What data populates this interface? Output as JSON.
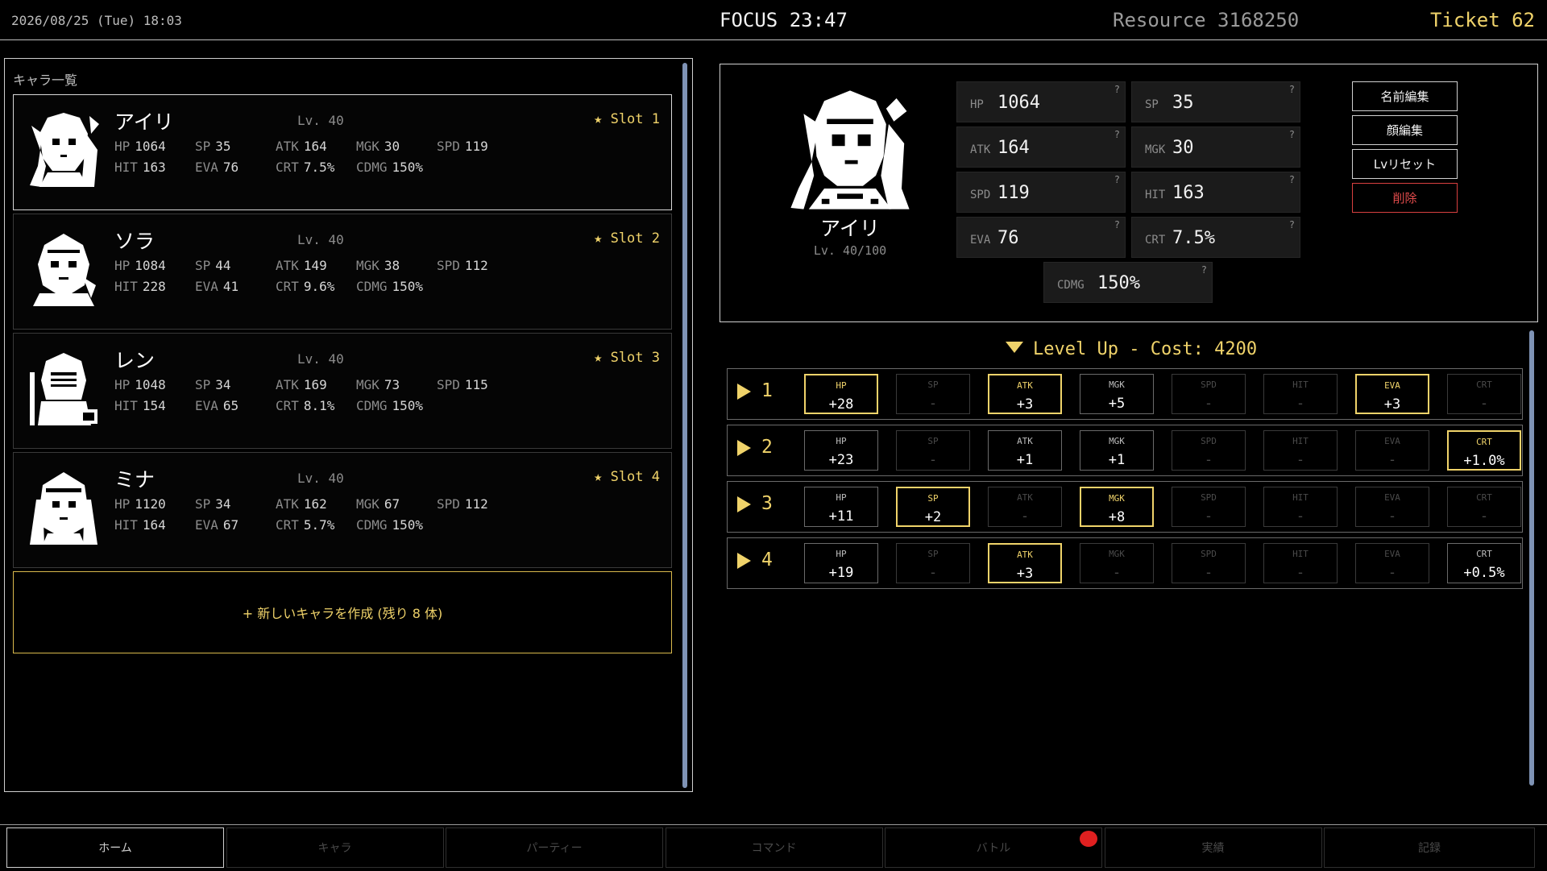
{
  "topbar": {
    "datetime": "2026/08/25 (Tue) 18:03",
    "focus": "FOCUS 23:47",
    "resource": "Resource 3168250",
    "ticket": "Ticket 62"
  },
  "char_list": {
    "title": "キャラ一覧",
    "create_label": "+ 新しいキャラを作成 (残り 8 体)",
    "characters": [
      {
        "name": "アイリ",
        "level": "Lv. 40",
        "slot": "★ Slot 1",
        "HP": "1064",
        "SP": "35",
        "ATK": "164",
        "MGK": "30",
        "SPD": "119",
        "HIT": "163",
        "EVA": "76",
        "CRT": "7.5%",
        "CDMG": "150%"
      },
      {
        "name": "ソラ",
        "level": "Lv. 40",
        "slot": "★ Slot 2",
        "HP": "1084",
        "SP": "44",
        "ATK": "149",
        "MGK": "38",
        "SPD": "112",
        "HIT": "228",
        "EVA": "41",
        "CRT": "9.6%",
        "CDMG": "150%"
      },
      {
        "name": "レン",
        "level": "Lv. 40",
        "slot": "★ Slot 3",
        "HP": "1048",
        "SP": "34",
        "ATK": "169",
        "MGK": "73",
        "SPD": "115",
        "HIT": "154",
        "EVA": "65",
        "CRT": "8.1%",
        "CDMG": "150%"
      },
      {
        "name": "ミナ",
        "level": "Lv. 40",
        "slot": "★ Slot 4",
        "HP": "1120",
        "SP": "34",
        "ATK": "162",
        "MGK": "67",
        "SPD": "112",
        "HIT": "164",
        "EVA": "67",
        "CRT": "5.7%",
        "CDMG": "150%"
      }
    ]
  },
  "detail": {
    "name": "アイリ",
    "level": "Lv. 40/100",
    "stats": [
      {
        "key": "HP",
        "value": "1064"
      },
      {
        "key": "SP",
        "value": "35"
      },
      {
        "key": "ATK",
        "value": "164"
      },
      {
        "key": "MGK",
        "value": "30"
      },
      {
        "key": "SPD",
        "value": "119"
      },
      {
        "key": "HIT",
        "value": "163"
      },
      {
        "key": "EVA",
        "value": "76"
      },
      {
        "key": "CRT",
        "value": "7.5%"
      },
      {
        "key": "CDMG",
        "value": "150%"
      }
    ],
    "help_mark": "?",
    "buttons": {
      "rename": "名前編集",
      "face_edit": "顔編集",
      "lv_reset": "Lvリセット",
      "delete": "削除"
    }
  },
  "level_up": {
    "header": "Level Up - Cost: 4200",
    "rows": [
      {
        "num": "1",
        "cells": [
          {
            "k": "HP",
            "v": "+28",
            "s": "hl"
          },
          {
            "k": "SP",
            "v": "-",
            "s": "mute"
          },
          {
            "k": "ATK",
            "v": "+3",
            "s": "hl"
          },
          {
            "k": "MGK",
            "v": "+5",
            "s": "on"
          },
          {
            "k": "SPD",
            "v": "-",
            "s": "mute"
          },
          {
            "k": "HIT",
            "v": "-",
            "s": "mute"
          },
          {
            "k": "EVA",
            "v": "+3",
            "s": "hl"
          },
          {
            "k": "CRT",
            "v": "-",
            "s": "mute"
          }
        ]
      },
      {
        "num": "2",
        "cells": [
          {
            "k": "HP",
            "v": "+23",
            "s": "on"
          },
          {
            "k": "SP",
            "v": "-",
            "s": "mute"
          },
          {
            "k": "ATK",
            "v": "+1",
            "s": "on"
          },
          {
            "k": "MGK",
            "v": "+1",
            "s": "on"
          },
          {
            "k": "SPD",
            "v": "-",
            "s": "mute"
          },
          {
            "k": "HIT",
            "v": "-",
            "s": "mute"
          },
          {
            "k": "EVA",
            "v": "-",
            "s": "mute"
          },
          {
            "k": "CRT",
            "v": "+1.0%",
            "s": "hl"
          }
        ]
      },
      {
        "num": "3",
        "cells": [
          {
            "k": "HP",
            "v": "+11",
            "s": "on"
          },
          {
            "k": "SP",
            "v": "+2",
            "s": "hl"
          },
          {
            "k": "ATK",
            "v": "-",
            "s": "mute"
          },
          {
            "k": "MGK",
            "v": "+8",
            "s": "hl"
          },
          {
            "k": "SPD",
            "v": "-",
            "s": "mute"
          },
          {
            "k": "HIT",
            "v": "-",
            "s": "mute"
          },
          {
            "k": "EVA",
            "v": "-",
            "s": "mute"
          },
          {
            "k": "CRT",
            "v": "-",
            "s": "mute"
          }
        ]
      },
      {
        "num": "4",
        "cells": [
          {
            "k": "HP",
            "v": "+19",
            "s": "on"
          },
          {
            "k": "SP",
            "v": "-",
            "s": "mute"
          },
          {
            "k": "ATK",
            "v": "+3",
            "s": "hl"
          },
          {
            "k": "MGK",
            "v": "-",
            "s": "mute"
          },
          {
            "k": "SPD",
            "v": "-",
            "s": "mute"
          },
          {
            "k": "HIT",
            "v": "-",
            "s": "mute"
          },
          {
            "k": "EVA",
            "v": "-",
            "s": "mute"
          },
          {
            "k": "CRT",
            "v": "+0.5%",
            "s": "on"
          }
        ]
      }
    ]
  },
  "nav": {
    "tabs": [
      "ホーム",
      "キャラ",
      "パーティー",
      "コマンド",
      "バトル",
      "実績",
      "記録"
    ],
    "active_index": 0
  },
  "colors": {
    "accent": "#f0d36a",
    "danger": "#e24c4c",
    "scrollbar": "#7f93b5",
    "badge": "#e02020"
  }
}
